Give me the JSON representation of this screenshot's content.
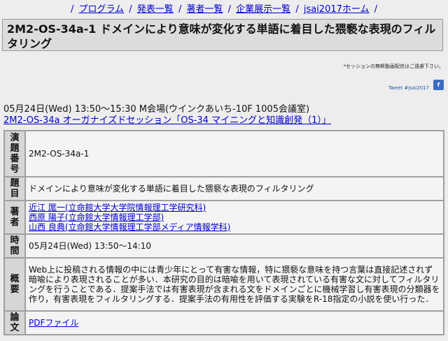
{
  "nav": {
    "sep": "/",
    "items": [
      "プログラム",
      "発表一覧",
      "著者一覧",
      "企業展示一覧",
      "jsai2017ホーム"
    ]
  },
  "title": "2M2-OS-34a-1 ドメインにより意味が変化する単語に着目した猥褻な表現のフィルタリング",
  "notice": "*セッションの無断動画配信はご遠慮下さい。",
  "tweet": "Tweet #jsai2017",
  "fb_icon": "f",
  "session": {
    "time": "05月24日(Wed) 13:50〜15:30 M会場(ウインクあいち-10F 1005会議室)",
    "link": "2M2-OS-34a オーガナイズドセッション「OS-34 マイニングと知識創発（1）」"
  },
  "table": {
    "rows": [
      {
        "label": [
          "演",
          "題",
          "番",
          "号"
        ],
        "value": "2M2-OS-34a-1"
      },
      {
        "label": [
          "題",
          "目"
        ],
        "value": "ドメインにより意味が変化する単語に着目した猥褻な表現のフィルタリング"
      },
      {
        "label": [
          "著",
          "者"
        ],
        "authors": [
          "近江 厖一(立命館大学大学院情報理工学研究科)",
          "西原 陽子(立命館大学情報理工学部)",
          "山西 良典(立命館大学情報理工学部メディア情報学科)"
        ]
      },
      {
        "label": [
          "時",
          "間"
        ],
        "value": "05月24日(Wed) 13:50〜14:10"
      },
      {
        "label": [
          "概",
          "要"
        ],
        "value": "Web上に投稿される情報の中には青少年にとって有害な情報，特に猥褻な意味を持つ言葉は直接記述されず暗喩により表現されることが多い．本研究の目的は暗喩を用いて表現されている有害な文に対してフィルタリングを行うことである．提案手法では有害表現が含まれる文をドメインごとに機械学習し有害表現の分類器を作り，有害表現をフィルタリングする．提案手法の有用性を評価する実験をR-18指定の小説を使い行った．"
      },
      {
        "label": [
          "論",
          "文"
        ],
        "value": "PDFファイル"
      }
    ]
  }
}
